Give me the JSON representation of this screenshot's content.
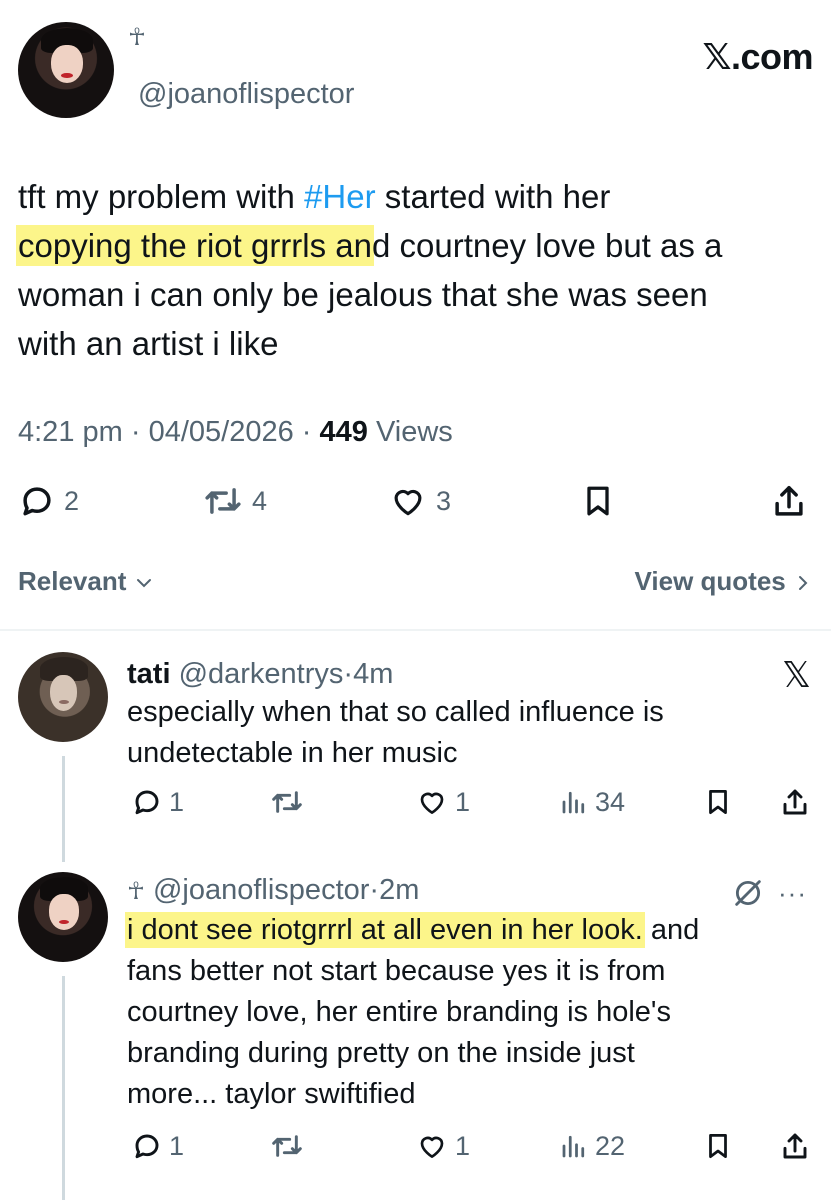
{
  "brand": "𝕏.com",
  "main_tweet": {
    "handle": "@joanoflispector",
    "name_glyph": "☥",
    "text_lines": [
      {
        "before": "tft my problem with ",
        "hashtag": "#Her",
        "after": " started with her"
      },
      {
        "highlight": "copying the riot grrrls an",
        "after": "d courtney love but as a"
      },
      {
        "text": "woman i can only be jealous that she was seen"
      },
      {
        "text": "with an artist i like"
      }
    ],
    "time": "4:21 pm",
    "date": "04/05/2026",
    "views_count": "449",
    "views_label": "Views",
    "replies": "2",
    "reposts": "4",
    "likes": "3"
  },
  "filter": {
    "sort_label": "Relevant",
    "quotes_label": "View quotes"
  },
  "replies": [
    {
      "name": "tati",
      "handle": "@darkentrys",
      "time": "4m",
      "lines": [
        "especially when that so called influence is",
        "undetectable in her music"
      ],
      "replies": "1",
      "likes": "1",
      "views": "34",
      "corner_icon": "x-logo-icon"
    },
    {
      "name_glyph": "☥",
      "handle": "@joanoflispector",
      "time": "2m",
      "highlight": "i dont see riotgrrrl at all even in her look.",
      "first_rest": " and",
      "lines": [
        "fans better not start because yes it is from",
        "courtney love, her entire branding is hole's",
        "branding during pretty on the inside just",
        "more... taylor swiftified"
      ],
      "replies": "1",
      "likes": "1",
      "views": "22",
      "corner_icon": "no-views-icon",
      "more": "···"
    }
  ],
  "colors": {
    "text": "#0f1419",
    "secondary": "#536471",
    "link": "#1d9bf0",
    "highlight": "#fcf58a",
    "divider": "#eff3f4"
  }
}
